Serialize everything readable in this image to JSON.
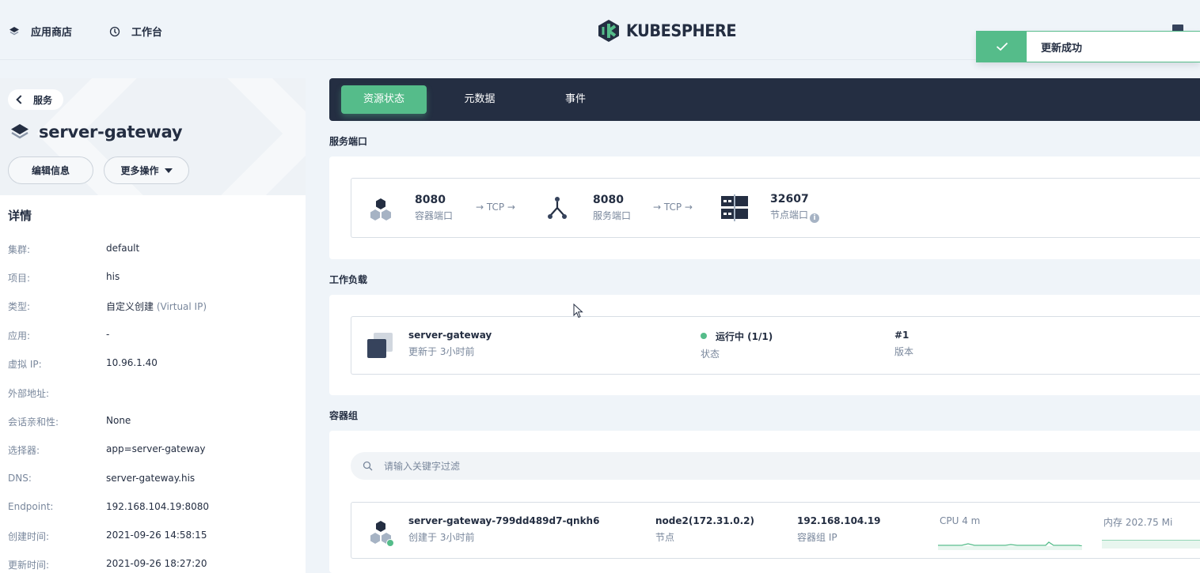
{
  "topnav": {
    "app_store": "应用商店",
    "workbench": "工作台",
    "logo_text": "KUBESPHERE"
  },
  "toast": {
    "message": "更新成功"
  },
  "left": {
    "back_label": "服务",
    "title": "server-gateway",
    "edit_label": "编辑信息",
    "more_label": "更多操作",
    "details_title": "详情",
    "details": [
      {
        "key": "集群:",
        "value": "default"
      },
      {
        "key": "项目:",
        "value": "his"
      },
      {
        "key": "类型:",
        "value": "自定义创建",
        "extra": "(Virtual IP)"
      },
      {
        "key": "应用:",
        "value": "-"
      },
      {
        "key": "虚拟 IP:",
        "value": "10.96.1.40"
      },
      {
        "key": "外部地址:",
        "value": ""
      },
      {
        "key": "会话亲和性:",
        "value": "None"
      },
      {
        "key": "选择器:",
        "value": "app=server-gateway"
      },
      {
        "key": "DNS:",
        "value": "server-gateway.his"
      },
      {
        "key": "Endpoint:",
        "value": "192.168.104.19:8080"
      },
      {
        "key": "创建时间:",
        "value": "2021-09-26 14:58:15"
      },
      {
        "key": "更新时间:",
        "value": "2021-09-26 18:27:20"
      }
    ]
  },
  "tabs": [
    "资源状态",
    "元数据",
    "事件"
  ],
  "ports": {
    "section_title": "服务端口",
    "container_port": "8080",
    "container_port_label": "容器端口",
    "service_port": "8080",
    "service_port_label": "服务端口",
    "node_port": "32607",
    "node_port_label": "节点端口",
    "arrow1": "→ TCP →",
    "arrow2": "→ TCP →",
    "info_glyph": "i"
  },
  "workload": {
    "section_title": "工作负载",
    "name": "server-gateway",
    "updated": "更新于 3小时前",
    "status": "运行中 (1/1)",
    "status_label": "状态",
    "version": "#1",
    "version_label": "版本"
  },
  "pods": {
    "section_title": "容器组",
    "search_placeholder": "请输入关键字过滤",
    "name": "server-gateway-799dd489d7-qnkh6",
    "created": "创建于 3小时前",
    "node": "node2(172.31.0.2)",
    "node_label": "节点",
    "pod_ip": "192.168.104.19",
    "pod_ip_label": "容器组 IP",
    "cpu_label": "CPU 4 m",
    "mem_label": "内存 202.75 Mi"
  },
  "colors": {
    "accent": "#55bc8a",
    "dark": "#242e42",
    "muted": "#79879c"
  }
}
